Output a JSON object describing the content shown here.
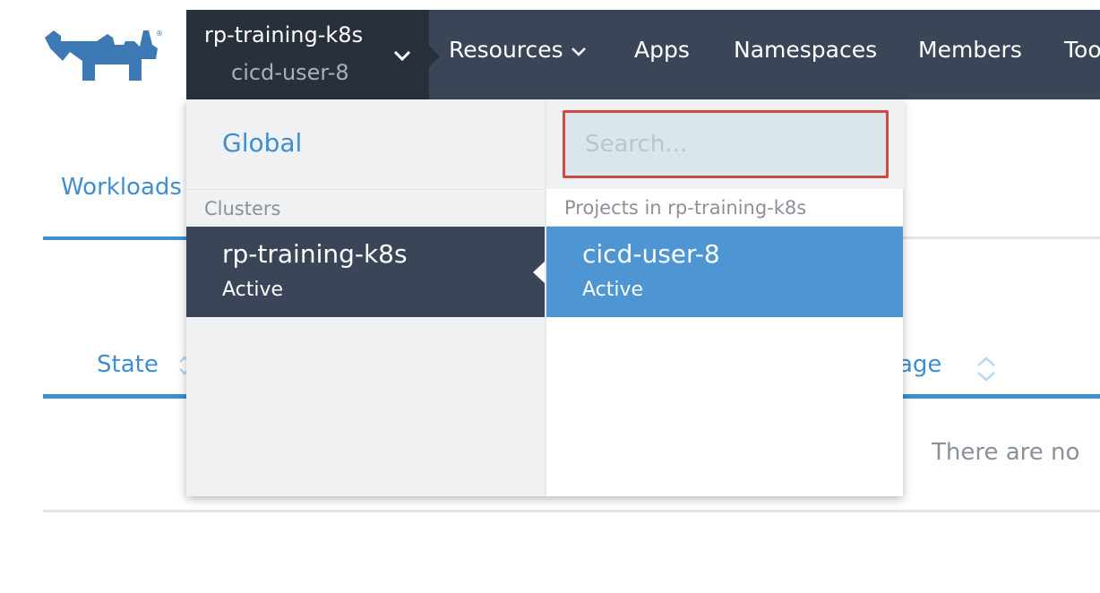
{
  "brand": {
    "logo": "rancher-logo",
    "color": "#3d7ab5"
  },
  "header": {
    "cluster_name": "rp-training-k8s",
    "project_name": "cicd-user-8",
    "nav": [
      {
        "label": "Resources",
        "has_dropdown": true
      },
      {
        "label": "Apps"
      },
      {
        "label": "Namespaces"
      },
      {
        "label": "Members"
      },
      {
        "label": "Too"
      }
    ]
  },
  "page": {
    "tab_label": "Workloads",
    "columns": {
      "state": "State",
      "image": "Image"
    },
    "empty_message": "There are no"
  },
  "switcher": {
    "global_label": "Global",
    "search_placeholder": "Search...",
    "clusters_heading": "Clusters",
    "projects_heading": "Projects in rp-training-k8s",
    "clusters": [
      {
        "name": "rp-training-k8s",
        "state": "Active"
      }
    ],
    "projects": [
      {
        "name": "cicd-user-8",
        "state": "Active"
      }
    ]
  },
  "colors": {
    "nav_bg": "#3a4658",
    "switch_bg": "#28303c",
    "accent": "#3d8ed3",
    "selected_project": "#4e95d4",
    "search_border": "#d04a44"
  }
}
